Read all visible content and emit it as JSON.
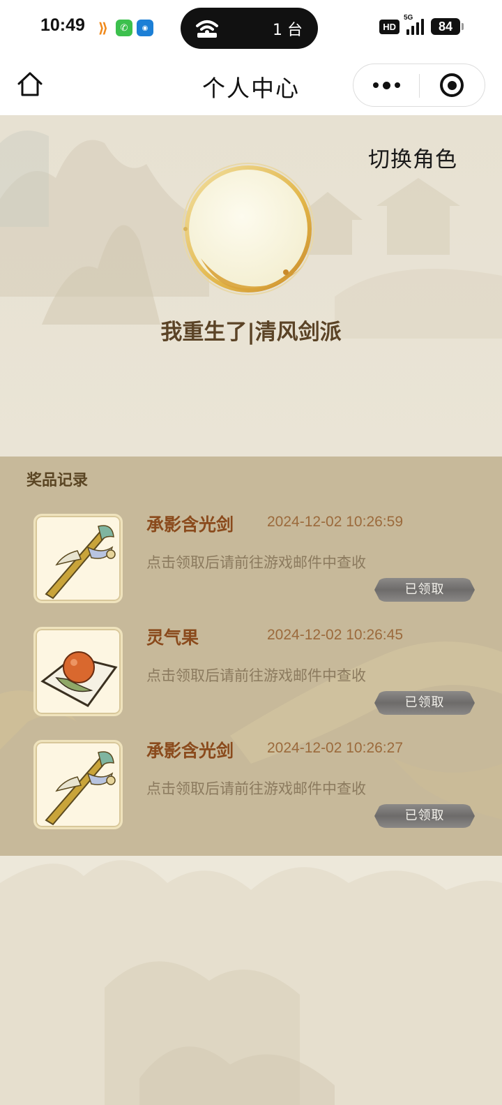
{
  "status_bar": {
    "time": "10:49",
    "hd_label": "HD",
    "network_label": "5G",
    "battery": "84",
    "island_count": "1 台"
  },
  "nav": {
    "title": "个人中心"
  },
  "profile": {
    "switch_role_label": "切换角色",
    "name": "我重生了|清风剑派"
  },
  "prizes": {
    "title": "奖品记录",
    "items": [
      {
        "name": "承影含光剑",
        "time": "2024-12-02 10:26:59",
        "desc": "点击领取后请前往游戏邮件中查收",
        "status": "已领取",
        "icon": "sword-icon"
      },
      {
        "name": "灵气果",
        "time": "2024-12-02 10:26:45",
        "desc": "点击领取后请前往游戏邮件中查收",
        "status": "已领取",
        "icon": "fruit-icon"
      },
      {
        "name": "承影含光剑",
        "time": "2024-12-02 10:26:27",
        "desc": "点击领取后请前往游戏邮件中查收",
        "status": "已领取",
        "icon": "sword-icon"
      }
    ]
  },
  "colors": {
    "panel_bg": "#c7b99a",
    "item_name": "#8a4a1c",
    "item_time": "#9b6a3c",
    "profile_name": "#5b4326"
  }
}
